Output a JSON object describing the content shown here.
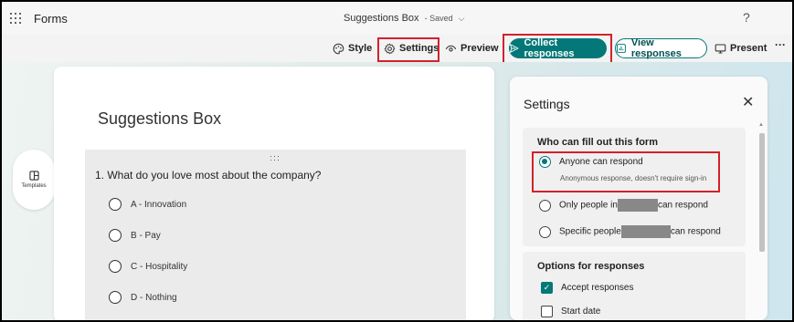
{
  "app": {
    "name": "Forms"
  },
  "header": {
    "form_title": "Suggestions Box",
    "status": "Saved",
    "help": "?"
  },
  "toolbar": {
    "style_label": "Style",
    "settings_label": "Settings",
    "preview_label": "Preview",
    "collect_label": "Collect responses",
    "view_label": "View responses",
    "present_label": "Present",
    "more": "···"
  },
  "sidebar": {
    "templates_label": "Templates"
  },
  "form": {
    "heading": "Suggestions Box",
    "question": "1. What do you love most about the company?",
    "options": [
      "A - Innovation",
      "B - Pay",
      "C - Hospitality",
      "D - Nothing"
    ]
  },
  "settings": {
    "title": "Settings",
    "who_heading": "Who can fill out this form",
    "anyone_label": "Anyone can respond",
    "anyone_sub": "Anonymous response, doesn't require sign-in",
    "only_prefix": "Only people in",
    "only_suffix": "can respond",
    "specific_prefix": "Specific people",
    "specific_suffix": "can respond",
    "options_heading": "Options for responses",
    "accept_label": "Accept responses",
    "start_label": "Start date"
  },
  "colors": {
    "accent": "#047878",
    "highlight": "#d3212b"
  }
}
